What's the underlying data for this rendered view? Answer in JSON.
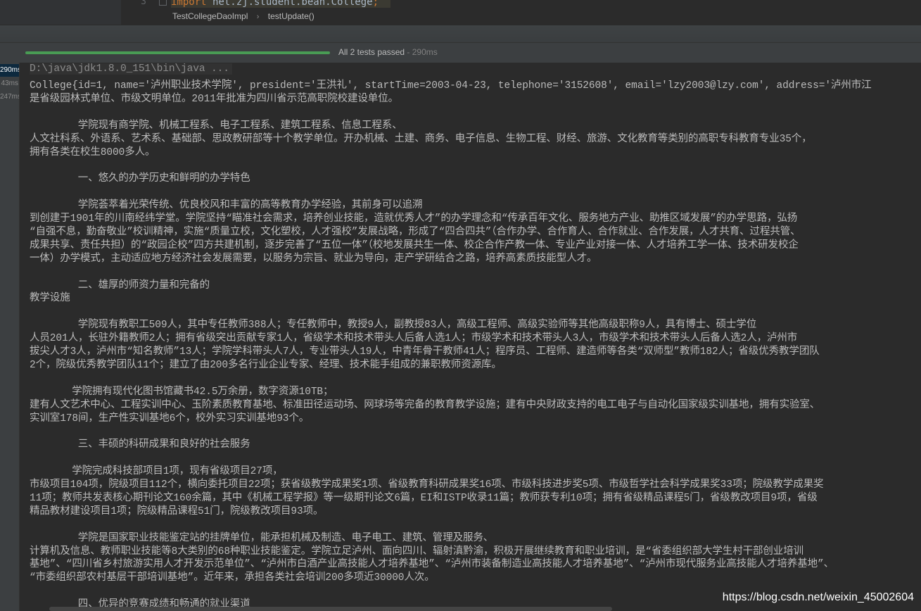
{
  "editor": {
    "line_number": "3",
    "code_keyword": "import",
    "code_rest": " net.zj.student.bean.College",
    "code_semi": ";",
    "breadcrumb": [
      "TestCollegeDaoImpl",
      "testUpdate()"
    ],
    "breadcrumb_separator": "›"
  },
  "test_status": {
    "text": "All 2 tests passed",
    "separator": " - ",
    "time": "290ms",
    "progress_percent": 100,
    "progress_color": "#499c54"
  },
  "timings": [
    "290ms",
    "43ms",
    "247ms"
  ],
  "console": {
    "command": "D:\\java\\jdk1.8.0_151\\bin\\java ...",
    "lines": [
      "College{id=1, name='泸州职业技术学院', president='王洪礼', startTime=2003-04-23, telephone='3152608', email='lzy2003@lzy.com', address='泸州市江",
      "是省级园林式单位、市级文明单位。2011年批准为四川省示范高职院校建设单位。",
      "",
      "        学院现有商学院、机械工程系、电子工程系、建筑工程系、信息工程系、",
      "人文社科系、外语系、艺术系、基础部、思政教研部等十个教学单位。开办机械、土建、商务、电子信息、生物工程、财经、旅游、文化教育等类别的高职专科教育专业35个，",
      "拥有各类在校生8000多人。",
      "",
      "        一、悠久的办学历史和鲜明的办学特色",
      "",
      "        学院荟萃着光荣传统、优良校风和丰富的高等教育办学经验，其前身可以追溯",
      "到创建于1901年的川南经纬学堂。学院坚持“瞄准社会需求，培养创业技能，造就优秀人才”的办学理念和“传承百年文化、服务地方产业、助推区域发展”的办学思路，弘扬",
      "“自强不息，勤奋敬业”校训精神，实施“质量立校，文化塑校，人才强校”发展战略，形成了“四合四共”（合作办学、合作育人、合作就业、合作发展，人才共育、过程共管、",
      "成果共享、责任共担）的“政园企校”四方共建机制，逐步完善了“五位一体”（校地发展共生一体、校企合作产教一体、专业产业对接一体、人才培养工学一体、技术研发校企",
      "一体）办学模式，主动适应地方经济社会发展需要，以服务为宗旨、就业为导向，走产学研结合之路，培养高素质技能型人才。",
      "",
      "        二、雄厚的师资力量和完备的",
      "教学设施",
      "",
      "        学院现有教职工509人，其中专任教师388人；专任教师中，教授9人，副教授83人，高级工程师、高级实验师等其他高级职称9人，具有博士、硕士学位",
      "人员201人，长驻外籍教师2人；拥有省级突出贡献专家1人，省级学术和技术带头人后备人选1人；市级学术和技术带头人3人，市级学术和技术带头人后备人选2人，泸州市",
      "拔尖人才3人，泸州市“知名教师”13人；学院学科带头人7人，专业带头人19人，中青年骨干教师41人；程序员、工程师、建造师等各类“双师型”教师182人；省级优秀教学团队",
      "2个，院级优秀教学团队11个；建立了由200多名行业企业专家、经理、技术能手组成的兼职教师资源库。",
      "",
      "       学院拥有现代化图书馆藏书42.5万余册，数字资源10TB；",
      "建有人文艺术中心、工程实训中心、玉阶素质教育基地、标准田径运动场、网球场等完备的教育教学设施；建有中央财政支持的电工电子与自动化国家级实训基地，拥有实验室、",
      "实训室178间，生产性实训基地6个，校外实习实训基地93个。",
      "",
      "        三、丰硕的科研成果和良好的社会服务",
      "",
      "       学院完成科技部项目1项，现有省级项目27项，",
      "市级项目104项，院级项目112个，横向委托项目22项；获省级教学成果奖1项、省级教育科研成果奖16项、市级科技进步奖5项、市级哲学社会科学成果奖33项；院级教学成果奖",
      "11项；教师共发表核心期刊论文160余篇，其中《机械工程学报》等一级期刊论文6篇，EI和ISTP收录11篇；教师获专利10项；拥有省级精品课程5门，省级教改项目9项，省级",
      "精品教材建设项目1项；院级精品课程51门，院级教改项目93项。",
      "",
      "        学院是国家职业技能鉴定站的挂牌单位，能承担机械及制造、电子电工、建筑、管理及服务、",
      "计算机及信息、教师职业技能等8大类别的68种职业技能鉴定。学院立足泸州、面向四川、辐射滇黔渝，积极开展继续教育和职业培训，是“省委组织部大学生村干部创业培训",
      "基地”、“四川省乡村旅游实用人才开发示范单位”、“泸州市白酒产业高技能人才培养基地”、“泸州市装备制造业高技能人才培养基地”、“泸州市现代服务业高技能人才培养基地”、",
      "“市委组织部农村基层干部培训基地”。近年来，承担各类社会培训200多项近30000人次。",
      "",
      "        四、优异的竞赛成绩和畅通的就业渠道"
    ]
  },
  "watermark": "https://blog.csdn.net/weixin_45002604"
}
